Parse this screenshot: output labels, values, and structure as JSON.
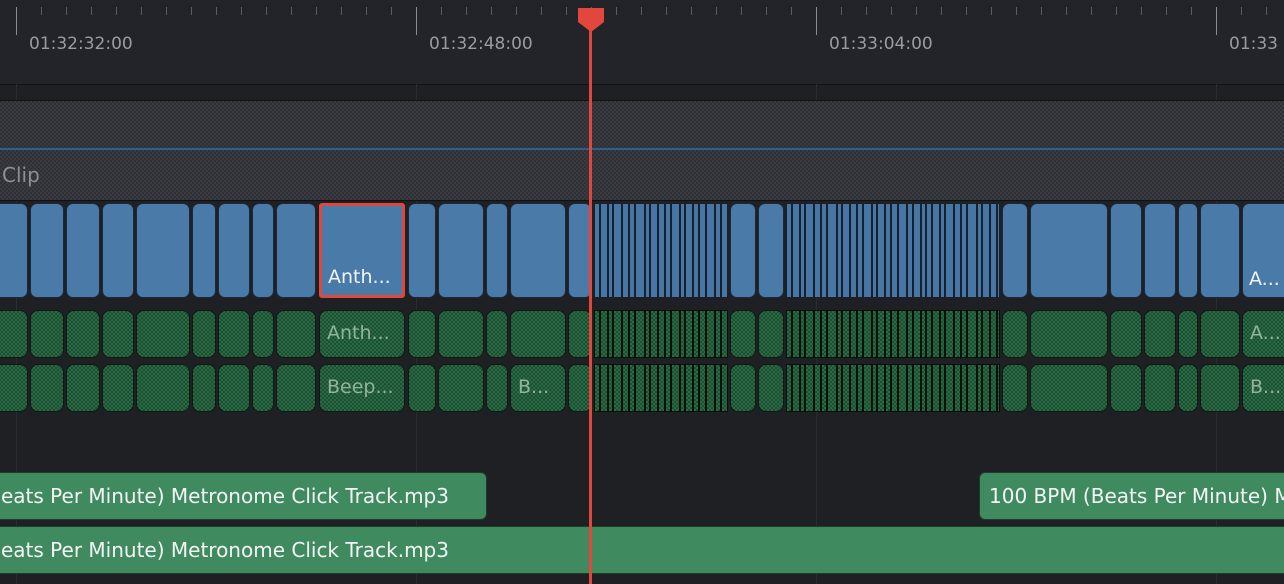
{
  "ruler": {
    "timecodes": [
      "01:32:32:00",
      "01:32:48:00",
      "01:33:04:00",
      "01:33"
    ]
  },
  "tracks": {
    "compound_clip_label": "Clip",
    "video": {
      "selected_clip_label": "Anth...",
      "edge_clip_label": "A..."
    },
    "audio_1": {
      "clip_label": "Anth...",
      "edge_clip_label": "A..."
    },
    "audio_2": {
      "clip_label": "Beep...",
      "mid_clip_label": "B...",
      "edge_clip_label": "B..."
    },
    "music_1": {
      "left_clip_label": "eats Per Minute) Metronome Click Track.mp3",
      "right_clip_label": "100 BPM (Beats Per Minute) M"
    },
    "music_2": {
      "clip_label": "eats Per Minute) Metronome Click Track.mp3"
    }
  },
  "colors": {
    "playhead": "#e2473e",
    "video_clip": "#4a7aa8",
    "audio_clip": "#2a6a44",
    "music_clip": "#3f8a5f",
    "selection": "#e2473e"
  }
}
